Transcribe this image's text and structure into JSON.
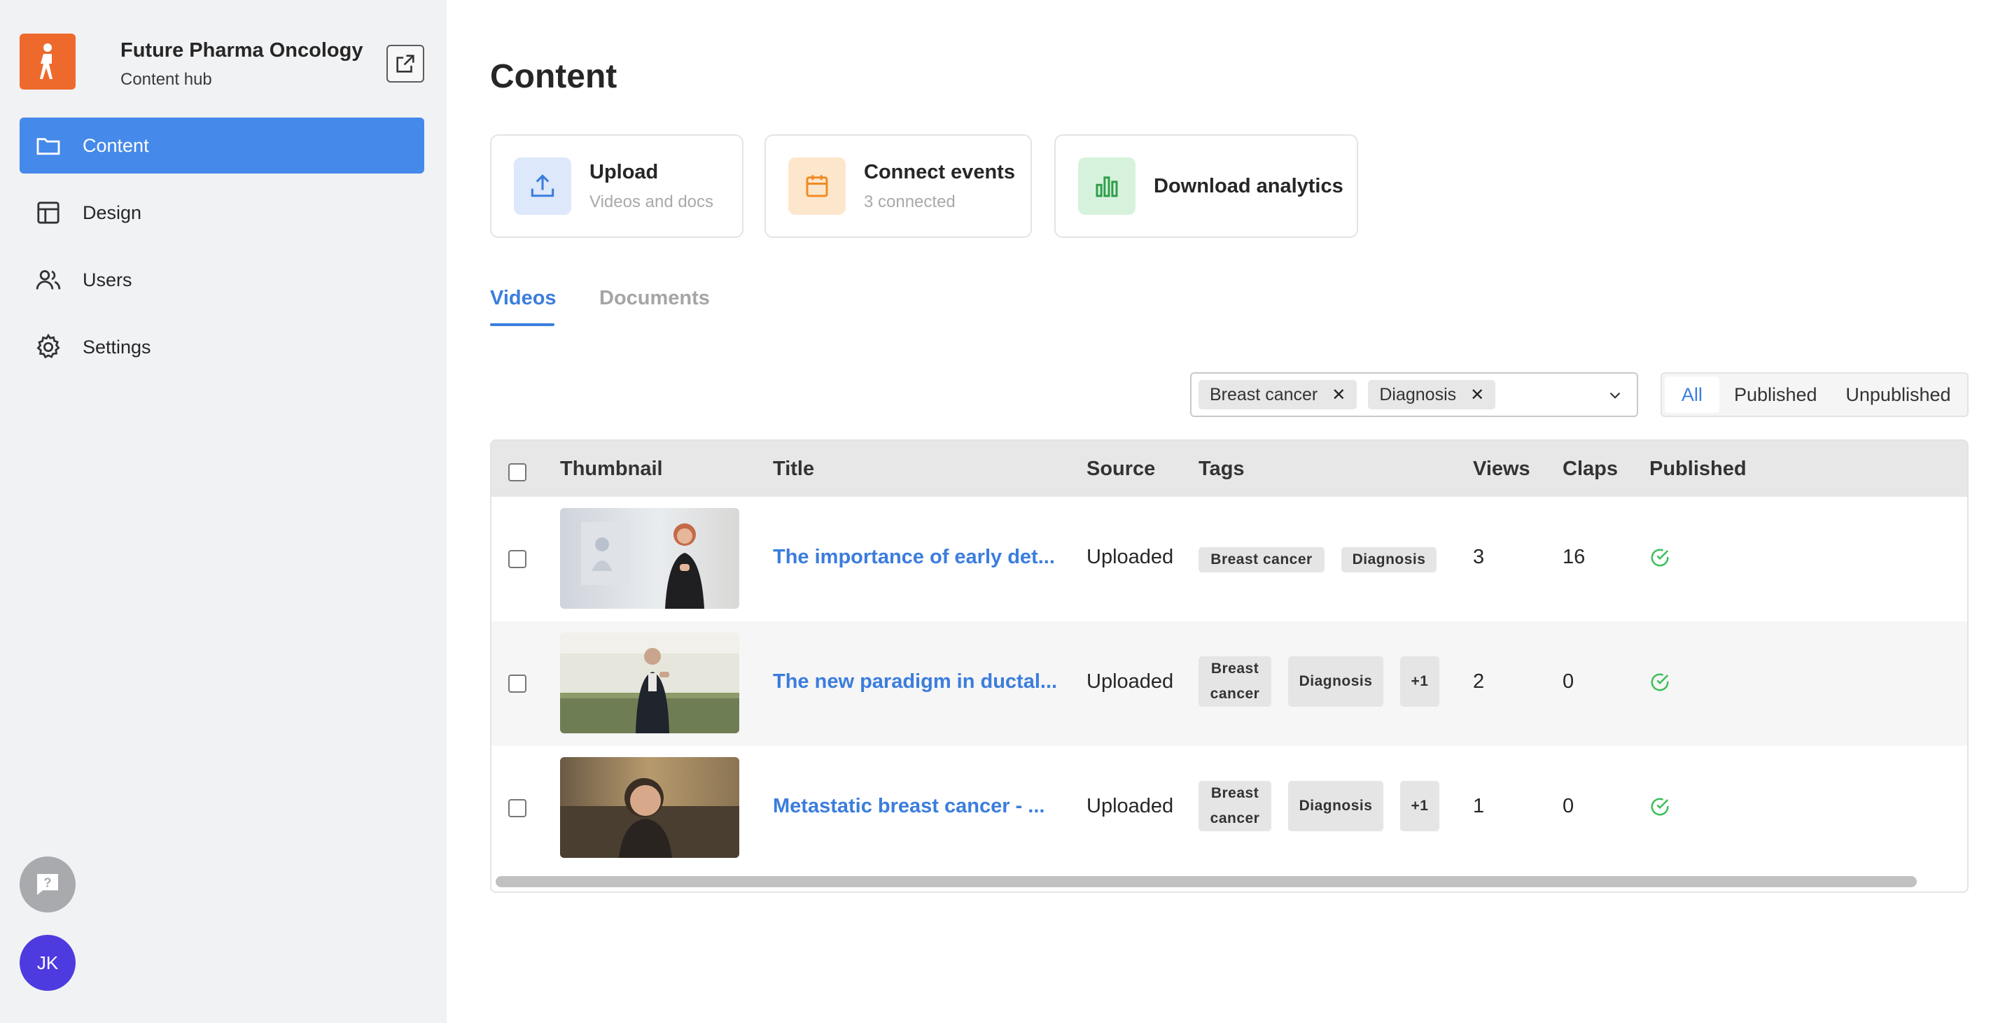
{
  "sidebar": {
    "org_name": "Future Pharma Oncology",
    "org_subtitle": "Content hub",
    "brand_color": "#ee6a2c",
    "nav": [
      {
        "label": "Content",
        "icon": "folder-icon",
        "active": true
      },
      {
        "label": "Design",
        "icon": "layout-icon",
        "active": false
      },
      {
        "label": "Users",
        "icon": "users-icon",
        "active": false
      },
      {
        "label": "Settings",
        "icon": "gear-icon",
        "active": false
      }
    ],
    "user_initials": "JK"
  },
  "main": {
    "title": "Content",
    "actions": [
      {
        "title": "Upload",
        "subtitle": "Videos and docs",
        "icon": "upload-icon"
      },
      {
        "title": "Connect events",
        "subtitle": "3 connected",
        "icon": "calendar-icon"
      },
      {
        "title": "Download analytics",
        "icon": "bar-chart-icon"
      }
    ],
    "tabs": [
      {
        "label": "Videos",
        "active": true
      },
      {
        "label": "Documents",
        "active": false
      }
    ],
    "filter_tags": [
      "Breast cancer",
      "Diagnosis"
    ],
    "status_filter": [
      "All",
      "Published",
      "Unpublished"
    ],
    "status_selected": "All",
    "table": {
      "columns": [
        "Thumbnail",
        "Title",
        "Source",
        "Tags",
        "Views",
        "Claps",
        "Published"
      ],
      "rows": [
        {
          "title": "The importance of early det...",
          "source": "Uploaded",
          "tags": [
            "Breast cancer",
            "Diagnosis"
          ],
          "views": "3",
          "claps": "16",
          "published": true
        },
        {
          "title": "The new paradigm in ductal...",
          "source": "Uploaded",
          "tags": [
            "Breast cancer",
            "Diagnosis",
            "+1"
          ],
          "views": "2",
          "claps": "0",
          "published": true
        },
        {
          "title": "Metastatic breast cancer - ...",
          "source": "Uploaded",
          "tags": [
            "Breast cancer",
            "Diagnosis",
            "+1"
          ],
          "views": "1",
          "claps": "0",
          "published": true
        }
      ]
    }
  },
  "colors": {
    "accent": "#3b7ddd",
    "nav_active": "#4589ea",
    "published_check": "#3cbf5a",
    "avatar": "#4d3be0"
  }
}
